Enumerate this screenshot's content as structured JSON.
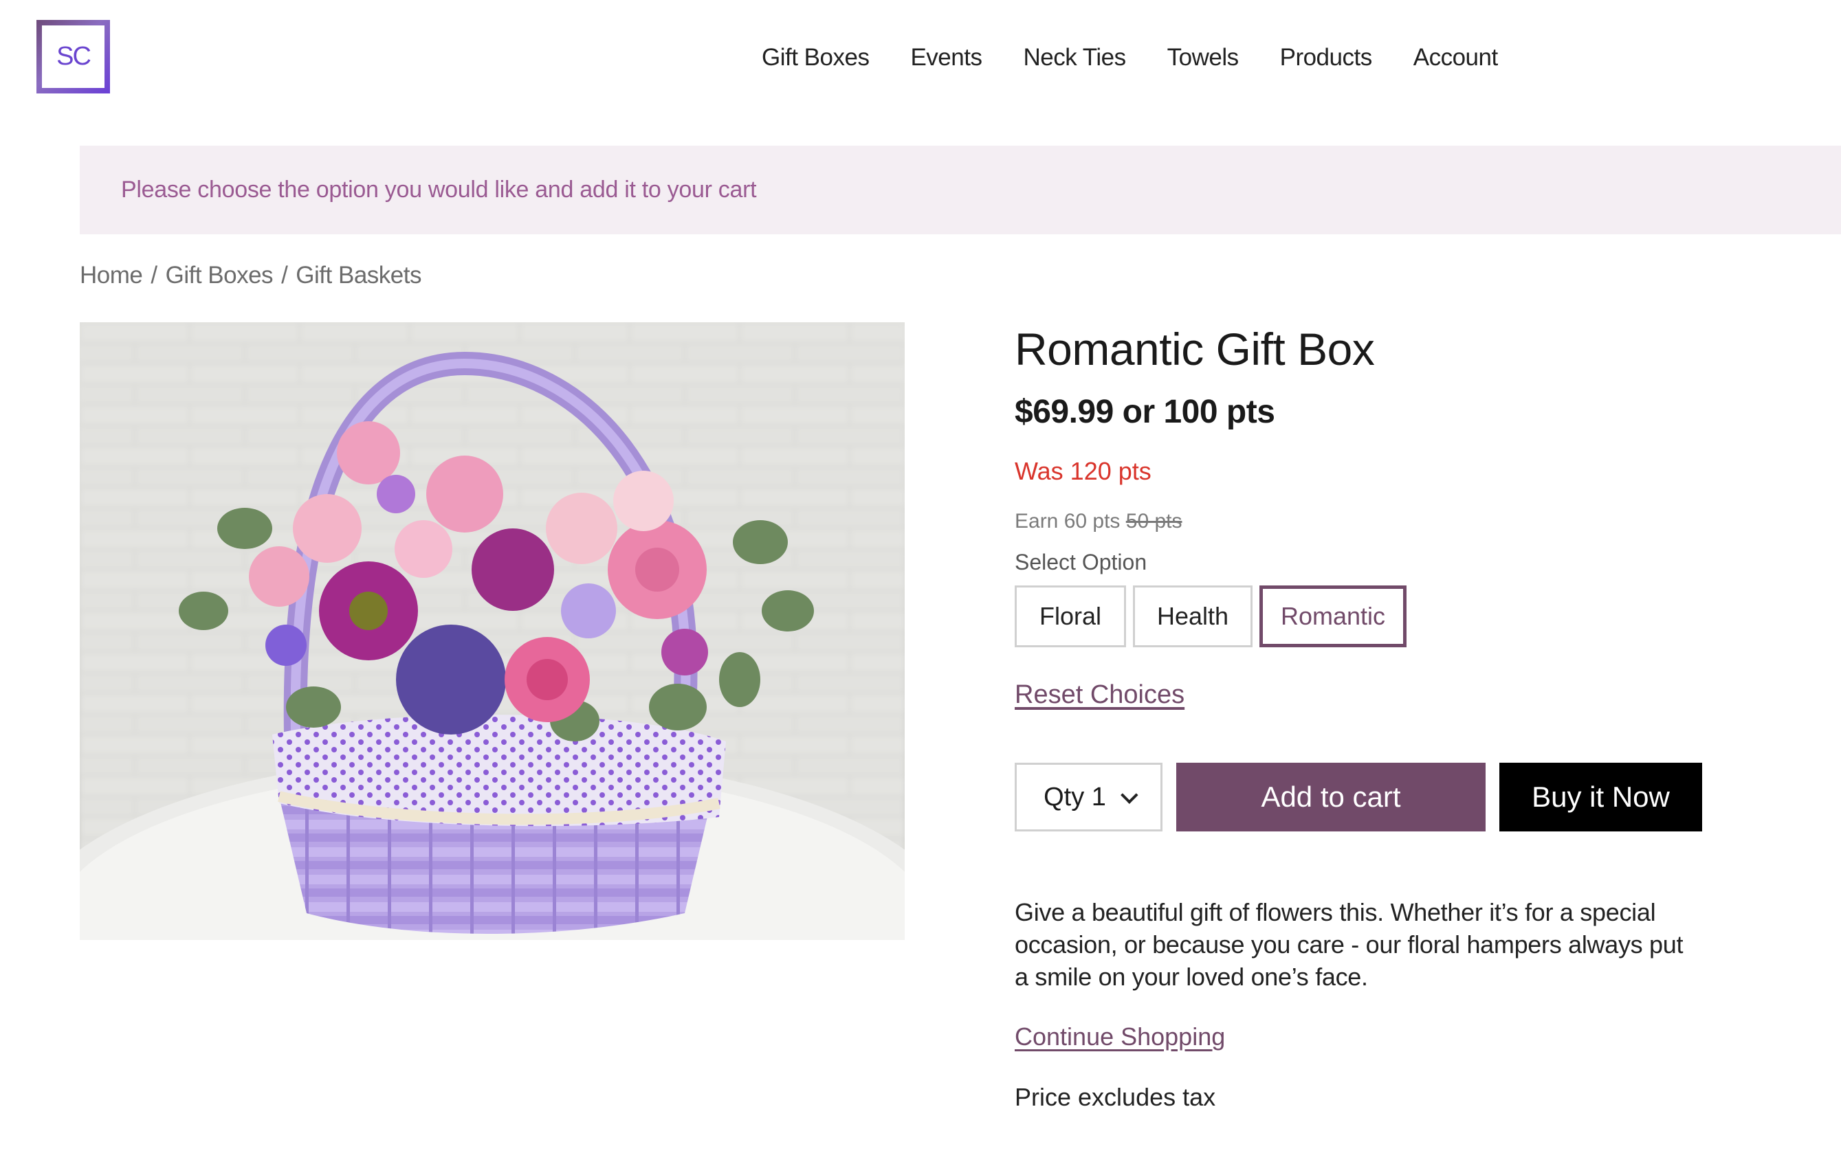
{
  "logo": {
    "text": "SC"
  },
  "nav": {
    "items": [
      "Gift Boxes",
      "Events",
      "Neck Ties",
      "Towels",
      "Products",
      "Account"
    ]
  },
  "banner": {
    "message": "Please choose the option you would like and add it to your cart"
  },
  "breadcrumb": {
    "items": [
      "Home",
      "Gift Boxes",
      "Gift Baskets"
    ],
    "separator": "/"
  },
  "product": {
    "image_alt": "Lavender wicker basket with pink roses, purple flowers and eucalyptus",
    "title": "Romantic Gift Box",
    "price": "$69.99 or 100 pts",
    "was_price": "Was 120 pts",
    "earn_label": "Earn 60 pts",
    "earn_old": "50 pts",
    "select_label": "Select Option",
    "options": [
      {
        "label": "Floral",
        "selected": false
      },
      {
        "label": "Health",
        "selected": false
      },
      {
        "label": "Romantic",
        "selected": true
      }
    ],
    "reset_label": "Reset Choices",
    "qty_label": "Qty 1",
    "qty_value": 1,
    "add_to_cart_label": "Add to cart",
    "buy_now_label": "Buy it Now",
    "description": "Give a beautiful gift of flowers this. Whether it’s for a special occasion, or because you care - our floral hampers always put a smile on your loved one’s face.",
    "continue_label": "Continue Shopping",
    "tax_note": "Price excludes tax"
  },
  "colors": {
    "accent": "#714a69",
    "banner_bg": "#f4eef3",
    "banner_text": "#9a5a92",
    "was_price": "#d9342b",
    "logo": "#6a45cf",
    "buy_now_bg": "#000000"
  }
}
